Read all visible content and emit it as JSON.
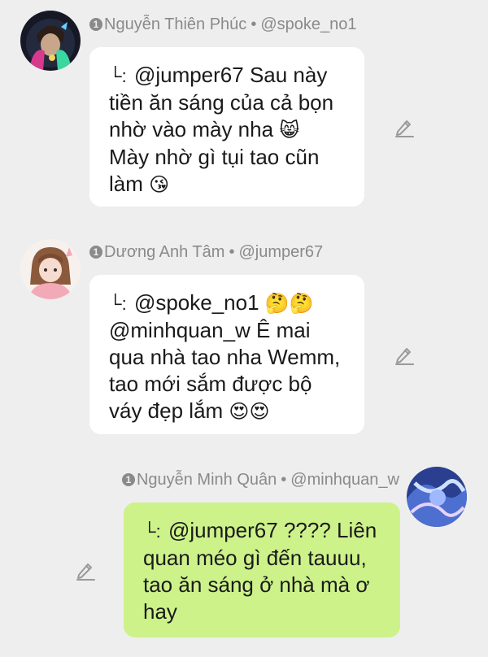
{
  "messages": [
    {
      "author": "Nguyễn Thiên Phúc",
      "handle": "@spoke_no1",
      "reply_mark": "└:",
      "lines": [
        "@jumper67 Sau này",
        "tiền ăn sáng của cả bọn",
        "nhờ vào mày nha",
        "Mày nhờ gì tụi tao cũn",
        "làm"
      ],
      "emojis": {
        "cat": "😸",
        "kiss": "😘"
      }
    },
    {
      "author": "Dương Anh Tâm",
      "handle": "@jumper67",
      "reply_mark": "└:",
      "lines": [
        "@spoke_no1",
        "@minhquan_w Ê mai",
        "qua nhà tao nha Wemm,",
        "tao mới sắm được bộ",
        "váy đẹp lắm"
      ],
      "emojis": {
        "thinking1": "🤔",
        "thinking2": "🤔",
        "heart_eyes1": "😍",
        "heart_eyes2": "😍"
      }
    },
    {
      "author": "Nguyễn Minh Quân",
      "handle": "@minhquan_w",
      "reply_mark": "└:",
      "lines": [
        "@jumper67 ???? Liên",
        "quan méo gì đến tauuu,",
        "tao ăn sáng ở nhà mà ơ",
        "hay"
      ],
      "emojis": {}
    }
  ],
  "badge": "1",
  "separator": "•",
  "icons": {
    "edit": "pencil-icon",
    "level": "level-badge-icon"
  },
  "colors": {
    "background": "#eeeeee",
    "bubble_other": "#ffffff",
    "bubble_mine": "#cdf28a",
    "meta_text": "#8a8a8a"
  }
}
